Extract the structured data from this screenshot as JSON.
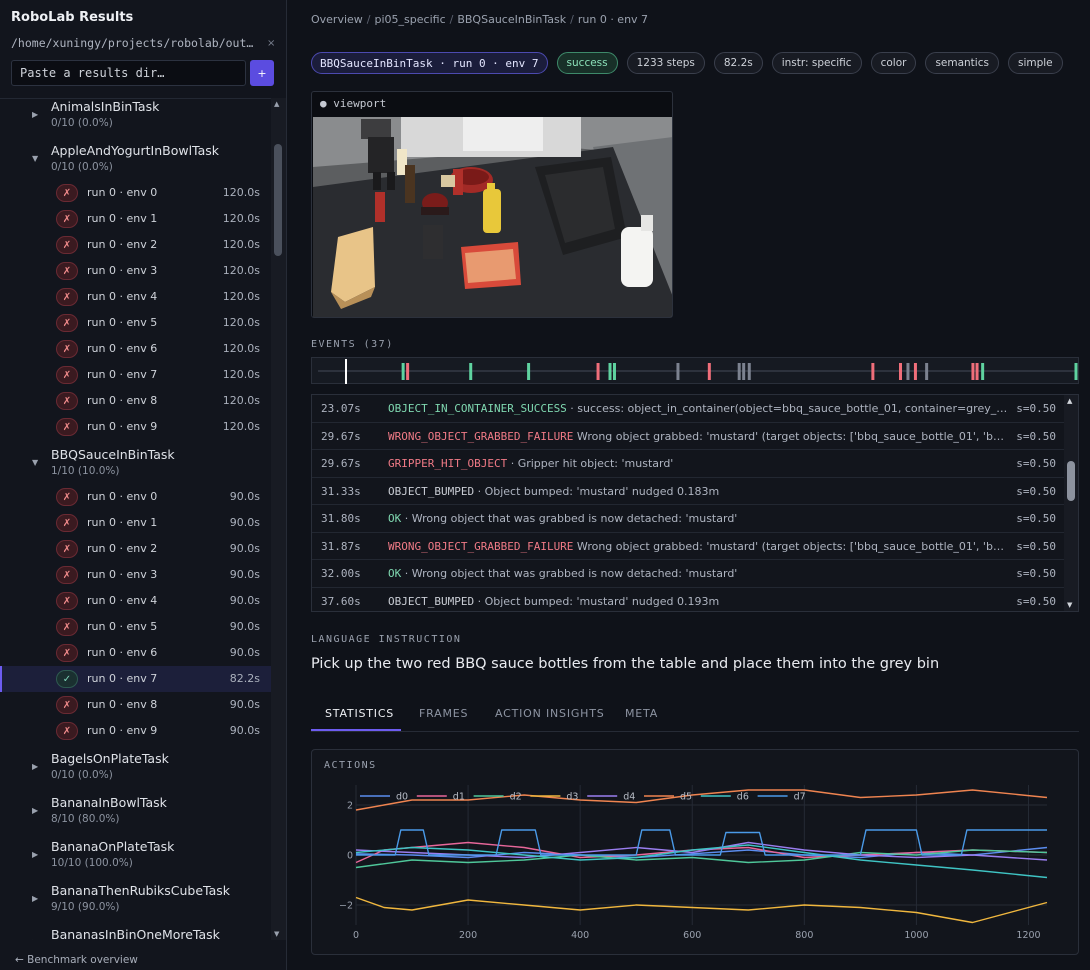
{
  "sidebar": {
    "title": "RoboLab Results",
    "results_path": "/home/xuningy/projects/robolab/out…",
    "clear_icon": "×",
    "dir_input_placeholder": "Paste a results dir…",
    "add_button_label": "+",
    "footer_link": "← Benchmark overview",
    "tasks": [
      {
        "name": "AnimalsInBinTask",
        "stats": "0/10 (0.0%)",
        "expanded": false,
        "runs": []
      },
      {
        "name": "AppleAndYogurtInBowlTask",
        "stats": "0/10 (0.0%)",
        "expanded": true,
        "runs": [
          {
            "label": "run 0 · env 0",
            "time": "120.0s",
            "status": "fail"
          },
          {
            "label": "run 0 · env 1",
            "time": "120.0s",
            "status": "fail"
          },
          {
            "label": "run 0 · env 2",
            "time": "120.0s",
            "status": "fail"
          },
          {
            "label": "run 0 · env 3",
            "time": "120.0s",
            "status": "fail"
          },
          {
            "label": "run 0 · env 4",
            "time": "120.0s",
            "status": "fail"
          },
          {
            "label": "run 0 · env 5",
            "time": "120.0s",
            "status": "fail"
          },
          {
            "label": "run 0 · env 6",
            "time": "120.0s",
            "status": "fail"
          },
          {
            "label": "run 0 · env 7",
            "time": "120.0s",
            "status": "fail"
          },
          {
            "label": "run 0 · env 8",
            "time": "120.0s",
            "status": "fail"
          },
          {
            "label": "run 0 · env 9",
            "time": "120.0s",
            "status": "fail"
          }
        ]
      },
      {
        "name": "BBQSauceInBinTask",
        "stats": "1/10 (10.0%)",
        "expanded": true,
        "runs": [
          {
            "label": "run 0 · env 0",
            "time": "90.0s",
            "status": "fail"
          },
          {
            "label": "run 0 · env 1",
            "time": "90.0s",
            "status": "fail"
          },
          {
            "label": "run 0 · env 2",
            "time": "90.0s",
            "status": "fail"
          },
          {
            "label": "run 0 · env 3",
            "time": "90.0s",
            "status": "fail"
          },
          {
            "label": "run 0 · env 4",
            "time": "90.0s",
            "status": "fail"
          },
          {
            "label": "run 0 · env 5",
            "time": "90.0s",
            "status": "fail"
          },
          {
            "label": "run 0 · env 6",
            "time": "90.0s",
            "status": "fail"
          },
          {
            "label": "run 0 · env 7",
            "time": "82.2s",
            "status": "success",
            "selected": true
          },
          {
            "label": "run 0 · env 8",
            "time": "90.0s",
            "status": "fail"
          },
          {
            "label": "run 0 · env 9",
            "time": "90.0s",
            "status": "fail"
          }
        ]
      },
      {
        "name": "BagelsOnPlateTask",
        "stats": "0/10 (0.0%)",
        "expanded": false,
        "runs": []
      },
      {
        "name": "BananaInBowlTask",
        "stats": "8/10 (80.0%)",
        "expanded": false,
        "runs": []
      },
      {
        "name": "BananaOnPlateTask",
        "stats": "10/10 (100.0%)",
        "expanded": false,
        "runs": []
      },
      {
        "name": "BananaThenRubiksCubeTask",
        "stats": "9/10 (90.0%)",
        "expanded": false,
        "runs": []
      },
      {
        "name": "BananasInBinOneMoreTask",
        "stats": "",
        "expanded": false,
        "runs": []
      }
    ]
  },
  "breadcrumb": [
    "Overview",
    "pi05_specific",
    "BBQSauceInBinTask",
    "run 0 · env 7"
  ],
  "chips": {
    "task": "BBQSauceInBinTask · run 0 · env 7",
    "status": "success",
    "steps": "1233 steps",
    "duration": "82.2s",
    "tags": [
      "instr: specific",
      "color",
      "semantics",
      "simple"
    ]
  },
  "viewport": {
    "label": "viewport"
  },
  "events": {
    "title": "EVENTS (37)",
    "timeline": {
      "x_min": 0,
      "x_max": 1233,
      "cursor": 75,
      "markers": [
        {
          "t": 228,
          "kind": "success"
        },
        {
          "t": 240,
          "kind": "failure"
        },
        {
          "t": 409,
          "kind": "success"
        },
        {
          "t": 564,
          "kind": "success"
        },
        {
          "t": 750,
          "kind": "failure"
        },
        {
          "t": 782,
          "kind": "success"
        },
        {
          "t": 794,
          "kind": "success"
        },
        {
          "t": 964,
          "kind": "neutral"
        },
        {
          "t": 1048,
          "kind": "failure"
        },
        {
          "t": 1128,
          "kind": "neutral"
        },
        {
          "t": 1140,
          "kind": "neutral"
        },
        {
          "t": 1155,
          "kind": "neutral"
        },
        {
          "t": 1486,
          "kind": "failure"
        },
        {
          "t": 1560,
          "kind": "failure"
        },
        {
          "t": 1580,
          "kind": "neutral"
        },
        {
          "t": 1600,
          "kind": "failure"
        },
        {
          "t": 1630,
          "kind": "neutral"
        },
        {
          "t": 1754,
          "kind": "failure"
        },
        {
          "t": 1765,
          "kind": "failure"
        },
        {
          "t": 1780,
          "kind": "success"
        },
        {
          "t": 2030,
          "kind": "success"
        }
      ]
    },
    "rows": [
      {
        "time": "23.07s",
        "type": "OBJECT_IN_CONTAINER_SUCCESS",
        "kind": "success",
        "message": " · success: object_in_container(object=bbq_sauce_bottle_01, container=grey_bin, req…",
        "score": "s=0.50"
      },
      {
        "time": "29.67s",
        "type": "WRONG_OBJECT_GRABBED_FAILURE",
        "kind": "failure",
        "message": " Wrong object grabbed: 'mustard' (target objects: ['bbq_sauce_bottle_01', 'bbq_sau…",
        "score": "s=0.50"
      },
      {
        "time": "29.67s",
        "type": "GRIPPER_HIT_OBJECT",
        "kind": "failure",
        "message": " · Gripper hit object: 'mustard'",
        "score": "s=0.50"
      },
      {
        "time": "31.33s",
        "type": "OBJECT_BUMPED",
        "kind": "neutral",
        "message": " · Object bumped: 'mustard' nudged 0.183m",
        "score": "s=0.50"
      },
      {
        "time": "31.80s",
        "type": "OK",
        "kind": "success",
        "message": " · Wrong object that was grabbed is now detached: 'mustard'",
        "score": "s=0.50"
      },
      {
        "time": "31.87s",
        "type": "WRONG_OBJECT_GRABBED_FAILURE",
        "kind": "failure",
        "message": " Wrong object grabbed: 'mustard' (target objects: ['bbq_sauce_bottle_01', 'bbq_sau…",
        "score": "s=0.50"
      },
      {
        "time": "32.00s",
        "type": "OK",
        "kind": "success",
        "message": " · Wrong object that was grabbed is now detached: 'mustard'",
        "score": "s=0.50"
      },
      {
        "time": "37.60s",
        "type": "OBJECT_BUMPED",
        "kind": "neutral",
        "message": " · Object bumped: 'mustard' nudged 0.193m",
        "score": "s=0.50"
      }
    ]
  },
  "language": {
    "title": "LANGUAGE INSTRUCTION",
    "text": "Pick up the two red BBQ sauce bottles from the table and place them into the grey bin"
  },
  "tabs": [
    "STATISTICS",
    "FRAMES",
    "ACTION INSIGHTS",
    "META"
  ],
  "active_tab": "STATISTICS",
  "colors": {
    "accent": "#6d5cf0",
    "success": "#5fd3a0",
    "failure": "#f06e7a",
    "neutral": "#7c8290"
  },
  "chart_data": {
    "type": "line",
    "title": "ACTIONS",
    "xlim": [
      0,
      1233
    ],
    "ylim": [
      -2.8,
      2.8
    ],
    "x_ticks": [
      0,
      200,
      400,
      600,
      800,
      1000,
      1200
    ],
    "y_ticks": [
      2,
      0,
      -2
    ],
    "y_tick_labels": [
      "2",
      "0",
      "−2"
    ],
    "legend_position": "top",
    "series": [
      {
        "name": "d0",
        "color": "#5b8def",
        "points": [
          [
            0,
            0.05
          ],
          [
            100,
            0.0
          ],
          [
            200,
            -0.1
          ],
          [
            300,
            0.1
          ],
          [
            400,
            0.0
          ],
          [
            500,
            -0.1
          ],
          [
            600,
            0.05
          ],
          [
            700,
            0.2
          ],
          [
            800,
            0.0
          ],
          [
            900,
            -0.1
          ],
          [
            1000,
            0.1
          ],
          [
            1100,
            0.0
          ],
          [
            1233,
            0.3
          ]
        ]
      },
      {
        "name": "d1",
        "color": "#e8679a",
        "points": [
          [
            0,
            -0.3
          ],
          [
            50,
            0.2
          ],
          [
            100,
            0.3
          ],
          [
            200,
            0.5
          ],
          [
            300,
            0.3
          ],
          [
            400,
            -0.1
          ],
          [
            500,
            0.0
          ],
          [
            600,
            0.2
          ],
          [
            700,
            0.3
          ],
          [
            800,
            -0.1
          ],
          [
            900,
            0.0
          ],
          [
            1000,
            0.1
          ],
          [
            1100,
            0.2
          ],
          [
            1233,
            0.1
          ]
        ]
      },
      {
        "name": "d2",
        "color": "#4fc79a",
        "points": [
          [
            0,
            -0.5
          ],
          [
            100,
            -0.2
          ],
          [
            200,
            -0.3
          ],
          [
            300,
            -0.2
          ],
          [
            400,
            0.0
          ],
          [
            500,
            -0.2
          ],
          [
            600,
            -0.1
          ],
          [
            700,
            -0.3
          ],
          [
            800,
            -0.2
          ],
          [
            900,
            0.1
          ],
          [
            1000,
            0.0
          ],
          [
            1100,
            0.2
          ],
          [
            1233,
            0.1
          ]
        ]
      },
      {
        "name": "d3",
        "color": "#f0b73e",
        "points": [
          [
            0,
            -1.7
          ],
          [
            50,
            -2.1
          ],
          [
            100,
            -2.2
          ],
          [
            200,
            -1.8
          ],
          [
            300,
            -2.0
          ],
          [
            400,
            -2.2
          ],
          [
            500,
            -2.0
          ],
          [
            600,
            -2.1
          ],
          [
            700,
            -2.2
          ],
          [
            800,
            -2.0
          ],
          [
            900,
            -2.1
          ],
          [
            1000,
            -2.3
          ],
          [
            1100,
            -2.7
          ],
          [
            1233,
            -1.9
          ]
        ]
      },
      {
        "name": "d4",
        "color": "#9a7ef0",
        "points": [
          [
            0,
            0.2
          ],
          [
            100,
            0.1
          ],
          [
            200,
            0.0
          ],
          [
            300,
            -0.1
          ],
          [
            400,
            0.1
          ],
          [
            500,
            0.3
          ],
          [
            600,
            0.1
          ],
          [
            700,
            0.5
          ],
          [
            800,
            0.2
          ],
          [
            900,
            0.0
          ],
          [
            1000,
            -0.1
          ],
          [
            1100,
            0.0
          ],
          [
            1233,
            -0.2
          ]
        ]
      },
      {
        "name": "d5",
        "color": "#ef8450",
        "points": [
          [
            0,
            1.8
          ],
          [
            50,
            2.0
          ],
          [
            100,
            2.2
          ],
          [
            200,
            2.2
          ],
          [
            300,
            2.4
          ],
          [
            400,
            2.2
          ],
          [
            500,
            2.1
          ],
          [
            600,
            2.4
          ],
          [
            700,
            2.6
          ],
          [
            800,
            2.6
          ],
          [
            900,
            2.3
          ],
          [
            1000,
            2.4
          ],
          [
            1100,
            2.6
          ],
          [
            1233,
            2.3
          ]
        ]
      },
      {
        "name": "d6",
        "color": "#3fc4c4",
        "points": [
          [
            0,
            0.1
          ],
          [
            100,
            0.3
          ],
          [
            200,
            0.2
          ],
          [
            300,
            0.0
          ],
          [
            400,
            -0.2
          ],
          [
            500,
            -0.1
          ],
          [
            600,
            0.2
          ],
          [
            700,
            0.4
          ],
          [
            800,
            0.1
          ],
          [
            900,
            -0.2
          ],
          [
            1000,
            -0.4
          ],
          [
            1100,
            -0.6
          ],
          [
            1233,
            -0.9
          ]
        ]
      },
      {
        "name": "d7",
        "color": "#4a9ae8",
        "points": [
          [
            0,
            0.0
          ],
          [
            70,
            0.0
          ],
          [
            80,
            1.0
          ],
          [
            120,
            1.0
          ],
          [
            130,
            0.0
          ],
          [
            250,
            0.0
          ],
          [
            260,
            1.0
          ],
          [
            320,
            1.0
          ],
          [
            330,
            0.0
          ],
          [
            500,
            0.0
          ],
          [
            510,
            1.0
          ],
          [
            560,
            1.0
          ],
          [
            570,
            0.0
          ],
          [
            650,
            0.0
          ],
          [
            660,
            0.9
          ],
          [
            720,
            0.9
          ],
          [
            730,
            0.0
          ],
          [
            900,
            0.0
          ],
          [
            910,
            1.0
          ],
          [
            1000,
            1.0
          ],
          [
            1010,
            0.0
          ],
          [
            1080,
            0.0
          ],
          [
            1090,
            1.0
          ],
          [
            1233,
            1.0
          ]
        ]
      }
    ]
  }
}
